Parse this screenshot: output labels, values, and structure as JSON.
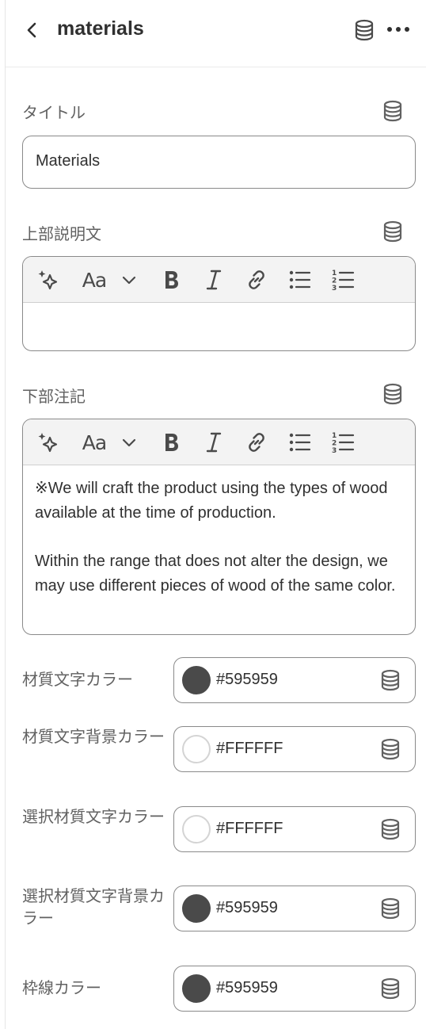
{
  "header": {
    "title": "materials",
    "back_icon": "chevron-left-icon",
    "db_icon": "database-icon",
    "more_icon": "ellipsis-icon"
  },
  "title_field": {
    "label": "タイトル",
    "value": "Materials"
  },
  "top_description": {
    "label": "上部説明文",
    "value": ""
  },
  "bottom_note": {
    "label": "下部注記",
    "paragraphs": [
      "※We will craft the product using the types of wood available at the time of production.",
      "Within the range that does not alter the design, we may use different pieces of wood of the same color."
    ]
  },
  "toolbar": {
    "font_label": "Aa",
    "items": [
      "magic-icon",
      "font-icon",
      "chevron-down-icon",
      "bold-icon",
      "italic-icon",
      "link-icon",
      "bullet-list-icon",
      "numbered-list-icon"
    ]
  },
  "colors": [
    {
      "label": "材質文字カラー",
      "hex": "#595959",
      "swatch": "#4a4a4a"
    },
    {
      "label": "材質文字背景カラー",
      "hex": "#FFFFFF",
      "swatch": "#ffffff"
    },
    {
      "label": "選択材質文字カラー",
      "hex": "#FFFFFF",
      "swatch": "#ffffff"
    },
    {
      "label": "選択材質文字背景カラー",
      "hex": "#595959",
      "swatch": "#4a4a4a"
    },
    {
      "label": "枠線カラー",
      "hex": "#595959",
      "swatch": "#4a4a4a"
    }
  ]
}
